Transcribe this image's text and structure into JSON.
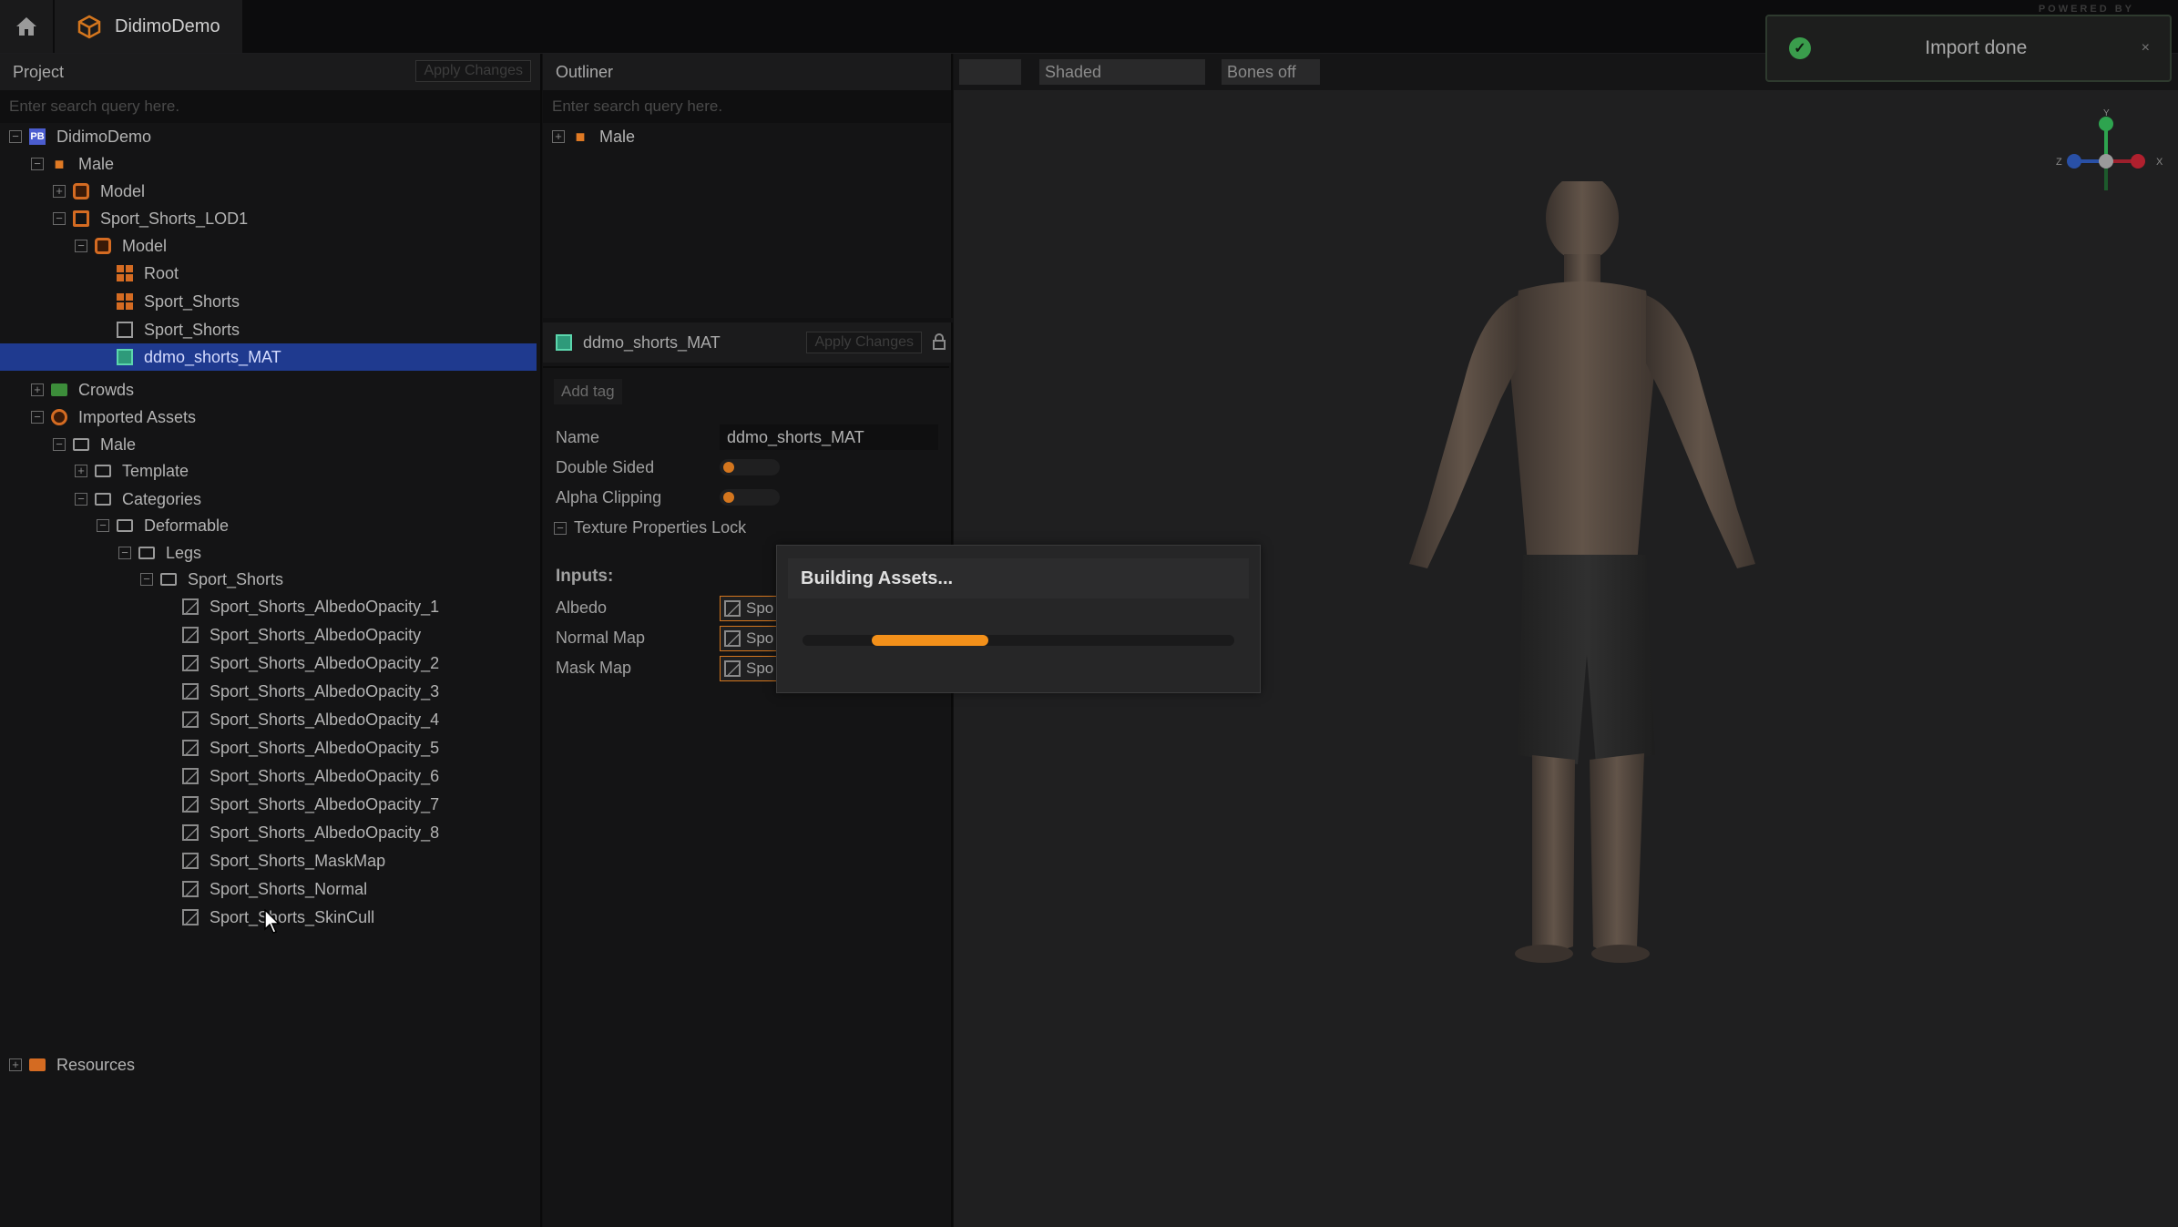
{
  "app": {
    "tab_title": "DidimoDemo",
    "powered_by": "POWERED BY"
  },
  "project": {
    "title": "Project",
    "apply_label": "Apply Changes",
    "search_placeholder": "Enter search query here.",
    "tree": [
      {
        "label": "DidimoDemo",
        "icon": "project-icon"
      },
      {
        "label": "Male",
        "icon": "avatar-icon"
      },
      {
        "label": "Model",
        "icon": "model-icon"
      },
      {
        "label": "Sport_Shorts_LOD1",
        "icon": "lod-icon"
      },
      {
        "label": "Model",
        "icon": "model-icon"
      },
      {
        "label": "Root",
        "icon": "skeleton-icon"
      },
      {
        "label": "Sport_Shorts",
        "icon": "skeleton-icon"
      },
      {
        "label": "Sport_Shorts",
        "icon": "mesh-icon"
      },
      {
        "label": "ddmo_shorts_MAT",
        "icon": "material-icon"
      },
      {
        "label": "Crowds",
        "icon": "folder-icon"
      },
      {
        "label": "Imported Assets",
        "icon": "imported-icon"
      },
      {
        "label": "Male",
        "icon": "folder-icon"
      },
      {
        "label": "Template",
        "icon": "folder-icon"
      },
      {
        "label": "Categories",
        "icon": "folder-icon"
      },
      {
        "label": "Deformable",
        "icon": "folder-icon"
      },
      {
        "label": "Legs",
        "icon": "folder-icon"
      },
      {
        "label": "Sport_Shorts",
        "icon": "folder-icon"
      },
      {
        "label": "Sport_Shorts_AlbedoOpacity_1",
        "icon": "texture-icon"
      },
      {
        "label": "Sport_Shorts_AlbedoOpacity",
        "icon": "texture-icon"
      },
      {
        "label": "Sport_Shorts_AlbedoOpacity_2",
        "icon": "texture-icon"
      },
      {
        "label": "Sport_Shorts_AlbedoOpacity_3",
        "icon": "texture-icon"
      },
      {
        "label": "Sport_Shorts_AlbedoOpacity_4",
        "icon": "texture-icon"
      },
      {
        "label": "Sport_Shorts_AlbedoOpacity_5",
        "icon": "texture-icon"
      },
      {
        "label": "Sport_Shorts_AlbedoOpacity_6",
        "icon": "texture-icon"
      },
      {
        "label": "Sport_Shorts_AlbedoOpacity_7",
        "icon": "texture-icon"
      },
      {
        "label": "Sport_Shorts_AlbedoOpacity_8",
        "icon": "texture-icon"
      },
      {
        "label": "Sport_Shorts_MaskMap",
        "icon": "texture-icon"
      },
      {
        "label": "Sport_Shorts_Normal",
        "icon": "texture-icon"
      },
      {
        "label": "Sport_Shorts_SkinCull",
        "icon": "texture-icon"
      },
      {
        "label": "Resources",
        "icon": "folder-icon"
      }
    ]
  },
  "outliner": {
    "title": "Outliner",
    "search_placeholder": "Enter search query here.",
    "items": [
      {
        "label": "Male"
      }
    ]
  },
  "properties": {
    "title": "ddmo_shorts_MAT",
    "apply_label": "Apply Changes",
    "add_tag_label": "Add tag",
    "name_label": "Name",
    "name_value": "ddmo_shorts_MAT",
    "double_sided_label": "Double Sided",
    "double_sided": false,
    "alpha_clipping_label": "Alpha Clipping",
    "alpha_clipping": false,
    "texture_lock_label": "Texture Properties Lock",
    "inputs_label": "Inputs:",
    "inputs": [
      {
        "label": "Albedo",
        "value": "Spo"
      },
      {
        "label": "Normal Map",
        "value": "Spo"
      },
      {
        "label": "Mask Map",
        "value": "Spo"
      }
    ]
  },
  "viewport": {
    "shading_label": "Shaded",
    "bones_label": "Bones off",
    "gizmo_axes": {
      "x": "X",
      "y": "Y",
      "z": "Z"
    }
  },
  "dialog": {
    "title": "Building Assets...",
    "progress_start": 0.16,
    "progress_end": 0.43,
    "accent": "#f3901a"
  },
  "toast": {
    "message": "Import done",
    "close": "×",
    "status_color": "#3a9d4c"
  }
}
